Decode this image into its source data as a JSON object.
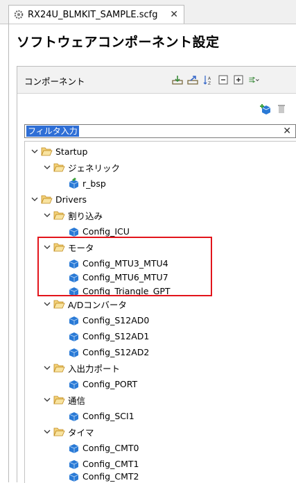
{
  "tab": {
    "title": "RX24U_BLMKIT_SAMPLE.scfg",
    "close": "✕"
  },
  "heading": "ソフトウェアコンポーネント設定",
  "panel": {
    "title": "コンポーネント",
    "filter_placeholder": "フィルタ入力",
    "filter_clear": "✕"
  },
  "tree": {
    "startup": {
      "label": "Startup",
      "generic": {
        "label": "ジェネリック",
        "items": [
          "r_bsp"
        ]
      }
    },
    "drivers": {
      "label": "Drivers",
      "interrupt": {
        "label": "割り込み",
        "items": [
          "Config_ICU"
        ]
      },
      "motor": {
        "label": "モータ",
        "items": [
          "Config_MTU3_MTU4",
          "Config_MTU6_MTU7",
          "Config_Triangle_GPT"
        ]
      },
      "adc": {
        "label": "A/Dコンバータ",
        "items": [
          "Config_S12AD0",
          "Config_S12AD1",
          "Config_S12AD2"
        ]
      },
      "io": {
        "label": "入出力ポート",
        "items": [
          "Config_PORT"
        ]
      },
      "comm": {
        "label": "通信",
        "items": [
          "Config_SCI1"
        ]
      },
      "timer": {
        "label": "タイマ",
        "items": [
          "Config_CMT0",
          "Config_CMT1",
          "Config_CMT2"
        ]
      }
    }
  },
  "colors": {
    "highlight": "#e2141b",
    "folder": "#e8b548",
    "cube": "#2a7ad6",
    "selection": "#2f6fd6"
  }
}
